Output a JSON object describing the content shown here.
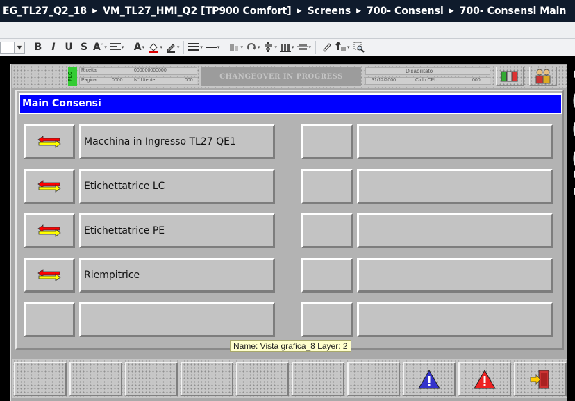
{
  "breadcrumb": [
    "EG_TL27_Q2_18",
    "VM_TL27_HMI_Q2 [TP900 Comfort]",
    "Screens",
    "700- Consensi",
    "700- Consensi Main"
  ],
  "toolbar": {
    "bold": "B",
    "italic": "I",
    "underline": "U",
    "strike": "S",
    "superscript": "A",
    "font_color": "A"
  },
  "hmi_header": {
    "plc_badge": "PLC",
    "recipe_label": "Ricetta",
    "recipe_value": "000000000000",
    "page_label": "Pagina",
    "page_value": "0000",
    "user_label": "N° Utente",
    "user_value": "000",
    "changeover_text": "CHANGEOVER IN PROGRESS",
    "status_text": "Disabilitato",
    "date_value": "31/12/2000",
    "cpu_label": "Ciclo CPU",
    "cpu_value": "000"
  },
  "panel": {
    "title": "Main Consensi",
    "rows": [
      {
        "label": "Macchina in Ingresso TL27 QE1",
        "has_arrow": true
      },
      {
        "label": "Etichettatrice LC",
        "has_arrow": true
      },
      {
        "label": "Etichettatrice PE",
        "has_arrow": true
      },
      {
        "label": "Riempitrice",
        "has_arrow": true
      },
      {
        "label": "",
        "has_arrow": false
      }
    ]
  },
  "tooltip": "Name: Vista grafica_8   Layer: 2",
  "right_edge_text": "TOUCH",
  "colors": {
    "title_bg": "#0000ff",
    "arrow_red": "#ff0000",
    "arrow_yellow": "#ffff00",
    "warning_blue": "#3333cc",
    "warning_red": "#ee2222",
    "plc_green": "#33cc33"
  },
  "icons": {
    "fkey_6": "warning-blue-icon",
    "fkey_7": "warning-red-icon",
    "fkey_8": "exit-door-icon",
    "hdr_btn_1": "traffic-light-icon",
    "hdr_btn_2": "users-icon"
  }
}
